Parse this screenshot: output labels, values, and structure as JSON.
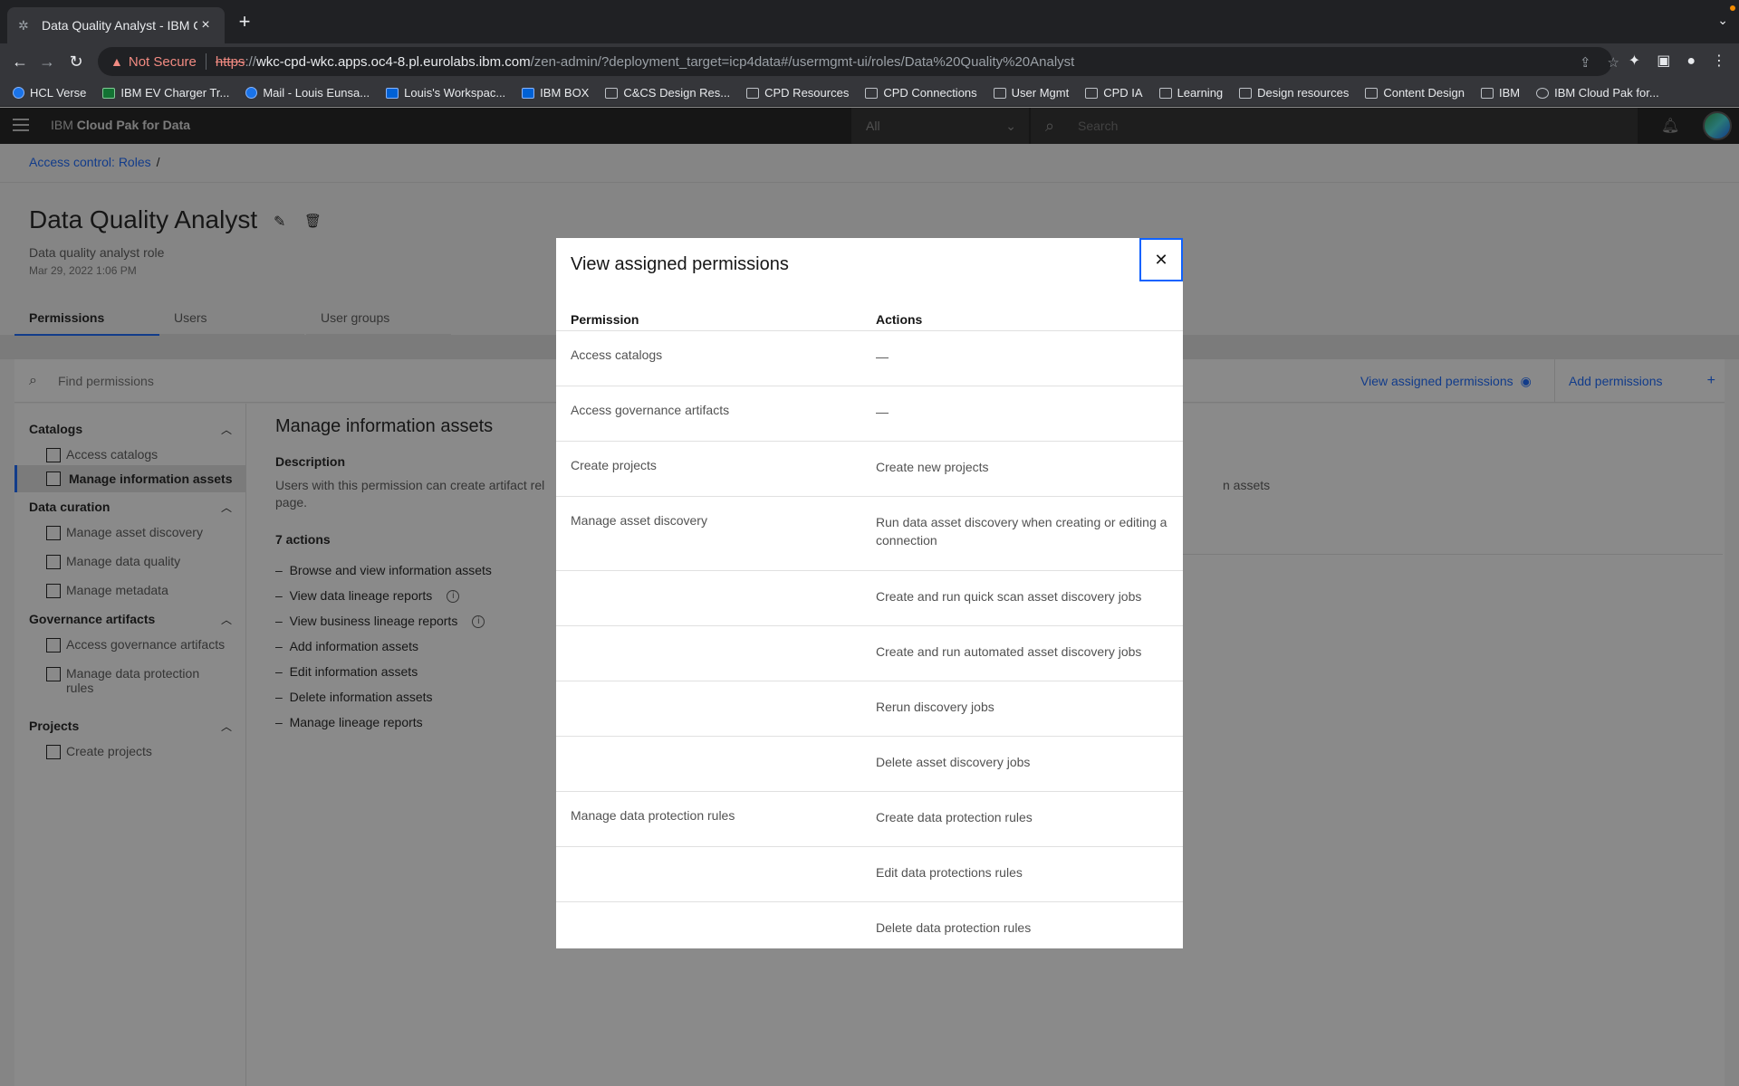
{
  "browser": {
    "tab_title": "Data Quality Analyst - IBM Clo",
    "not_secure": "Not Secure",
    "url_scheme": "https",
    "url_sep": "://",
    "url_host": "wkc-cpd-wkc.apps.oc4-8.pl.eurolabs.ibm.com",
    "url_path": "/zen-admin/?deployment_target=icp4data#/usermgmt-ui/roles/Data%20Quality%20Analyst",
    "bookmarks": [
      "HCL Verse",
      "IBM EV Charger Tr...",
      "Mail - Louis Eunsa...",
      "Louis's Workspac...",
      "IBM BOX",
      "C&CS Design Res...",
      "CPD Resources",
      "CPD Connections",
      "User Mgmt",
      "CPD IA",
      "Learning",
      "Design resources",
      "Content Design",
      "IBM",
      "IBM Cloud Pak for..."
    ]
  },
  "header": {
    "brand_prefix": "IBM",
    "brand_name": "Cloud Pak for Data",
    "scope_value": "All",
    "search_placeholder": "Search"
  },
  "page": {
    "breadcrumb": "Access control: Roles",
    "breadcrumb_sep": "/",
    "title": "Data Quality Analyst",
    "description": "Data quality analyst role",
    "date": "Mar 29, 2022 1:06 PM",
    "tabs": [
      "Permissions",
      "Users",
      "User groups"
    ],
    "find_placeholder": "Find permissions",
    "view_assigned": "View assigned permissions",
    "add_permissions": "Add permissions"
  },
  "sidebar": {
    "groups": [
      {
        "label": "Catalogs",
        "items": [
          "Access catalogs",
          "Manage information assets"
        ]
      },
      {
        "label": "Data curation",
        "items": [
          "Manage asset discovery",
          "Manage data quality",
          "Manage metadata"
        ]
      },
      {
        "label": "Governance artifacts",
        "items": [
          "Access governance artifacts",
          "Manage data protection",
          "rules"
        ]
      },
      {
        "label": "Projects",
        "items": [
          "Create projects"
        ]
      }
    ]
  },
  "main": {
    "title": "Manage information assets",
    "description_label": "Description",
    "description_line1": "Users with this permission can create artifact rel",
    "description_right": "n assets",
    "description_line2": "page.",
    "actions_count": "7 actions",
    "actions": [
      "Browse and view information assets",
      "View data lineage reports",
      "View business lineage reports",
      "Add information assets",
      "Edit information assets",
      "Delete information assets",
      "Manage lineage reports"
    ],
    "bullet": "–"
  },
  "modal": {
    "title": "View assigned permissions",
    "col_permission": "Permission",
    "col_actions": "Actions",
    "rows": [
      {
        "permission": "Access catalogs",
        "action": "—"
      },
      {
        "permission": "Access governance artifacts",
        "action": "—"
      },
      {
        "permission": "Create projects",
        "action": "Create new projects"
      },
      {
        "permission": "Manage asset discovery",
        "action": "Run data asset discovery when creating or editing a connection"
      },
      {
        "permission": "",
        "action": "Create and run quick scan asset discovery jobs"
      },
      {
        "permission": "",
        "action": "Create and run automated asset discovery jobs"
      },
      {
        "permission": "",
        "action": "Rerun discovery jobs"
      },
      {
        "permission": "",
        "action": "Delete asset discovery jobs"
      },
      {
        "permission": "Manage data protection rules",
        "action": "Create data protection rules"
      },
      {
        "permission": "",
        "action": "Edit data protections rules"
      },
      {
        "permission": "",
        "action": "Delete data protection rules"
      }
    ]
  }
}
